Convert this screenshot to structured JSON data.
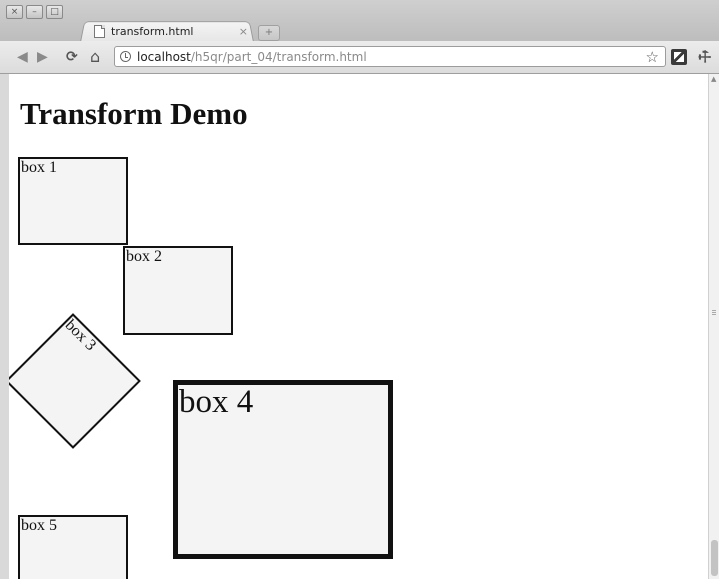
{
  "window": {
    "controls": [
      "×",
      "–",
      "□"
    ]
  },
  "tab": {
    "title": "transform.html",
    "close": "×",
    "new_tab": "+"
  },
  "toolbar": {
    "back": "◀",
    "forward": "▶",
    "reload": "⟳",
    "home": "⌂",
    "url_host": "localhost",
    "url_path": "/h5qr/part_04/transform.html",
    "star": "☆",
    "wrench": "🔧"
  },
  "page": {
    "title": "Transform Demo",
    "boxes": [
      {
        "label": "box 1"
      },
      {
        "label": "box 2"
      },
      {
        "label": "box 3"
      },
      {
        "label": "box 4"
      },
      {
        "label": "box 5"
      }
    ]
  }
}
